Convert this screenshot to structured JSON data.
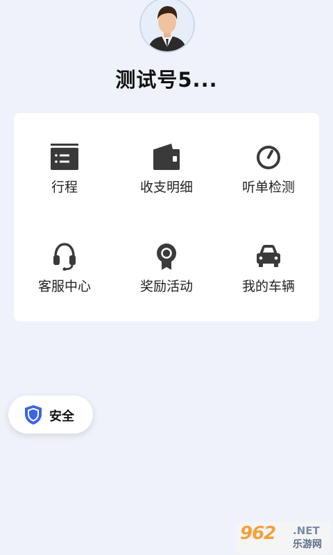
{
  "profile": {
    "username": "测试号5..."
  },
  "menu": {
    "items": [
      {
        "label": "行程",
        "icon": "trip-list-icon"
      },
      {
        "label": "收支明细",
        "icon": "wallet-icon"
      },
      {
        "label": "听单检测",
        "icon": "gauge-icon"
      },
      {
        "label": "客服中心",
        "icon": "headset-icon"
      },
      {
        "label": "奖励活动",
        "icon": "award-badge-icon"
      },
      {
        "label": "我的车辆",
        "icon": "car-icon"
      }
    ]
  },
  "safety": {
    "label": "安全",
    "icon": "shield-icon",
    "accent": "#3b64e8"
  },
  "watermark": {
    "brand": "962",
    "suffix": ".NET",
    "subtitle": "乐游网"
  },
  "colors": {
    "background": "#f0f2fb",
    "card": "#ffffff",
    "icon": "#3a3a3a"
  }
}
